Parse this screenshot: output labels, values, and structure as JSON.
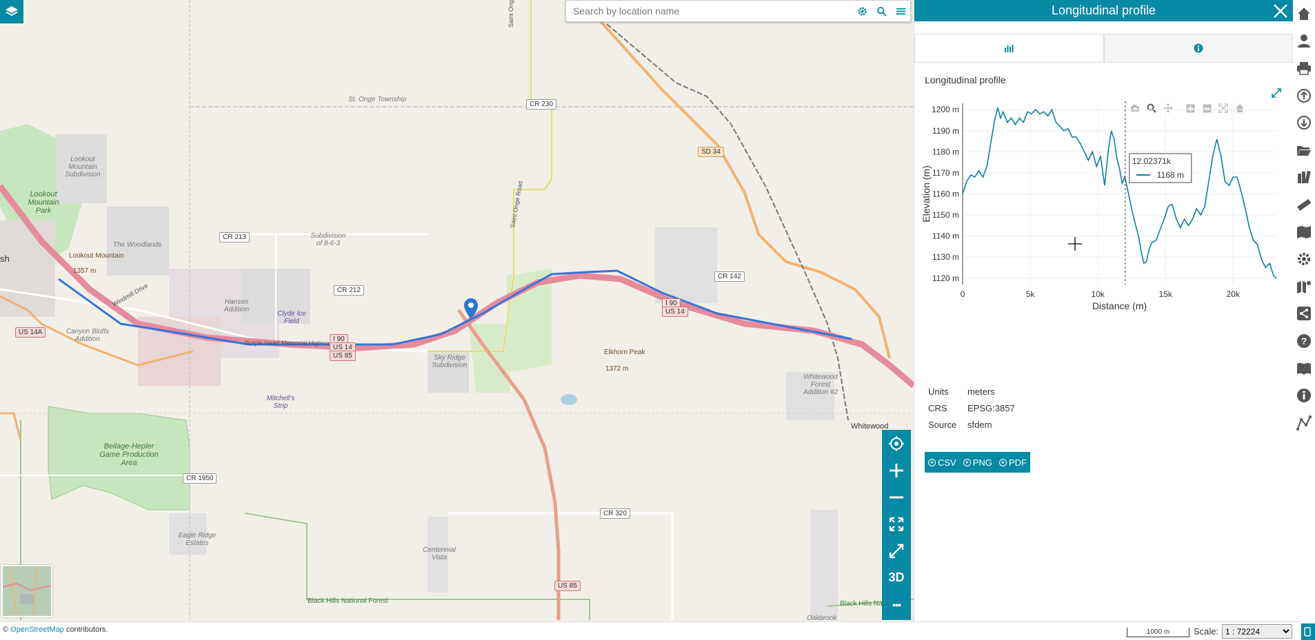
{
  "search": {
    "placeholder": "Search by location name"
  },
  "panel": {
    "title": "Longitudinal profile",
    "subtitle": "Longitudinal profile",
    "tabs": [
      {
        "icon": "bar-chart-icon"
      },
      {
        "icon": "info-icon"
      }
    ]
  },
  "meta": {
    "units_label": "Units",
    "units_value": "meters",
    "crs_label": "CRS",
    "crs_value": "EPSG:3857",
    "source_label": "Source",
    "source_value": "sfdem"
  },
  "export": {
    "csv": "CSV",
    "png": "PNG",
    "pdf": "PDF"
  },
  "map_tools": {
    "three_d": "3D",
    "more": "•••"
  },
  "bottom": {
    "attribution_prefix": "©",
    "attribution_link": "OpenStreetMap",
    "attribution_suffix": "contributors.",
    "scale_bar": "1000 m",
    "scale_label": "Scale:",
    "scale_value": "1 : 72224"
  },
  "map_labels": {
    "st_onge_township": "St. Onge Township",
    "lookout_mountain_park": "Lookout Mountain Park",
    "lookout_mountain_subdivision": "Lookout Mountain Subdivision",
    "the_woodlands": "The Woodlands",
    "lookout_mountain_peak": "Lookout Mountain",
    "lookout_mountain_elev": "1357 m",
    "hansen_addition": "Hansen Addition",
    "clyde_ice_field": "Clyde Ice Field",
    "subdivision_863": "Subdivision of 8-6-3",
    "canyon_bluffs": "Canyon Bluffs Addition",
    "sky_ridge": "Sky Ridge Subdivision",
    "elkhorn_peak": "Elkhorn Peak",
    "elkhorn_elev": "1372 m",
    "mitchells_strip": "Mitchell's Strip",
    "beilage": "Beilage-Hepler Game Production Area",
    "eagle_ridge": "Eagle Ridge Estates",
    "centennial_vista": "Centennial Vista",
    "black_hills": "Black Hills National Forest",
    "black_hills_right": "Black Hills Na",
    "whitewood": "Whitewood",
    "whitewood_forest": "Whitewood Forest Addition #2",
    "oakbrook": "Oakbrook",
    "sh": "sh",
    "windmill": "Windmill Drive",
    "saint_onge": "Saint Onge",
    "saint_onge_road": "Saint Onge Road",
    "purple_heart": "Purple Heart Memorial Highway"
  },
  "shields": {
    "cr230": "CR 230",
    "sd34": "SD 34",
    "cr213": "CR 213",
    "cr212": "CR 212",
    "cr142": "CR 142",
    "i90": "I 90",
    "us14": "US 14",
    "us85": "US 85",
    "i90b": "I 90",
    "us14b": "US 14",
    "us14a": "US 14A",
    "cr1950": "CR 1950",
    "cr320": "CR 320",
    "us85b": "US 85"
  },
  "chart_data": {
    "type": "line",
    "xlabel": "Distance (m)",
    "ylabel": "Elevation (m)",
    "xlim": [
      0,
      23200
    ],
    "ylim": [
      1117,
      1203
    ],
    "x_ticks": [
      0,
      5000,
      10000,
      15000,
      20000
    ],
    "x_tick_labels": [
      "0",
      "5k",
      "10k",
      "15k",
      "20k"
    ],
    "y_ticks": [
      1120,
      1130,
      1140,
      1150,
      1160,
      1170,
      1180,
      1190,
      1200
    ],
    "y_tick_labels": [
      "1120 m",
      "1130 m",
      "1140 m",
      "1150 m",
      "1160 m",
      "1170 m",
      "1180 m",
      "1190 m",
      "1200 m"
    ],
    "color": "#0a7fa0",
    "hover": {
      "x": 12023.71,
      "x_label": "12.02371k",
      "y_label": "1168 m"
    },
    "x": [
      0,
      300,
      600,
      900,
      1200,
      1500,
      1800,
      2100,
      2400,
      2600,
      2800,
      3000,
      3300,
      3600,
      3900,
      4200,
      4500,
      4800,
      5100,
      5400,
      5700,
      6000,
      6300,
      6600,
      6900,
      7200,
      7500,
      7800,
      8100,
      8400,
      8700,
      9000,
      9300,
      9600,
      9900,
      10200,
      10500,
      10800,
      11000,
      11200,
      11400,
      11600,
      11800,
      12000,
      12200,
      12400,
      12600,
      12800,
      13000,
      13200,
      13400,
      13600,
      13800,
      14000,
      14300,
      14600,
      14900,
      15200,
      15500,
      15800,
      16100,
      16400,
      16700,
      17000,
      17300,
      17600,
      17900,
      18200,
      18500,
      18800,
      19100,
      19400,
      19700,
      20000,
      20300,
      20600,
      20900,
      21200,
      21500,
      21800,
      22100,
      22400,
      22700,
      23000,
      23200
    ],
    "y": [
      1160,
      1166,
      1169,
      1168,
      1171,
      1168,
      1173,
      1185,
      1196,
      1201,
      1196,
      1199,
      1194,
      1196,
      1193,
      1196,
      1194,
      1199,
      1198,
      1200,
      1198,
      1199,
      1197,
      1200,
      1194,
      1192,
      1190,
      1191,
      1187,
      1187,
      1184,
      1180,
      1176,
      1180,
      1173,
      1178,
      1164,
      1182,
      1190,
      1186,
      1177,
      1172,
      1165,
      1168,
      1162,
      1156,
      1150,
      1145,
      1140,
      1133,
      1127,
      1128,
      1134,
      1137,
      1138,
      1143,
      1148,
      1154,
      1155,
      1148,
      1144,
      1148,
      1145,
      1148,
      1153,
      1150,
      1154,
      1166,
      1178,
      1186,
      1178,
      1166,
      1164,
      1168,
      1168,
      1161,
      1153,
      1144,
      1138,
      1136,
      1129,
      1125,
      1127,
      1121,
      1120
    ]
  }
}
